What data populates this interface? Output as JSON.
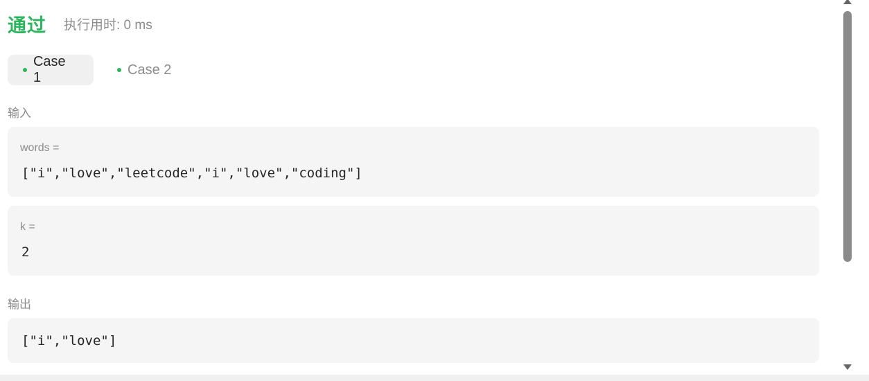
{
  "status": {
    "title": "通过",
    "runtime": "执行用时: 0 ms"
  },
  "cases": [
    {
      "label": "Case 1",
      "active": true
    },
    {
      "label": "Case 2",
      "active": false
    }
  ],
  "input": {
    "label": "输入",
    "params": [
      {
        "name": "words =",
        "value": "[\"i\",\"love\",\"leetcode\",\"i\",\"love\",\"coding\"]"
      },
      {
        "name": "k =",
        "value": "2"
      }
    ]
  },
  "output": {
    "label": "输出",
    "value": "[\"i\",\"love\"]"
  },
  "colors": {
    "accent_green": "#2db55d",
    "box_bg": "#f5f5f5",
    "muted_text": "#8c8c8c"
  }
}
